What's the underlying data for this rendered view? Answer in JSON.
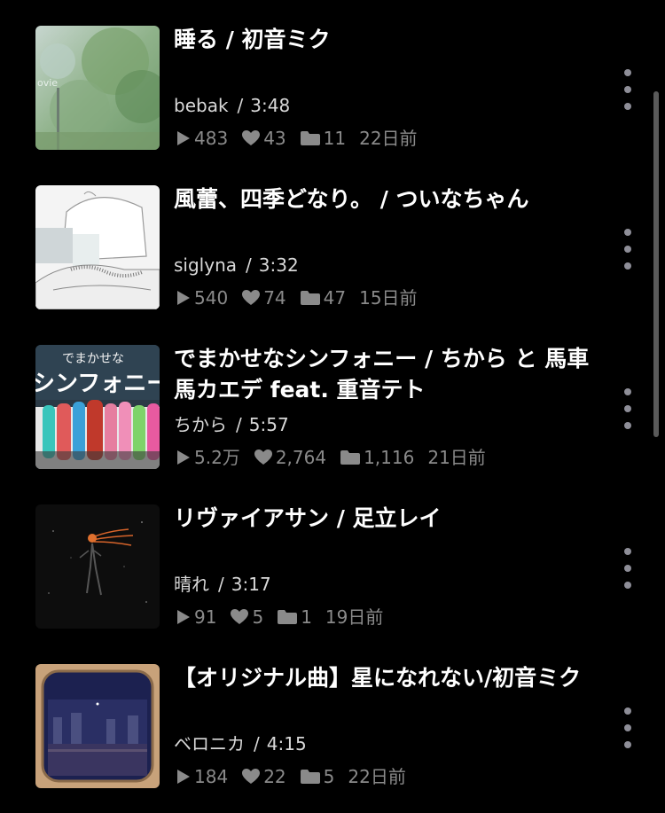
{
  "items": [
    {
      "title": "睡る / 初音ミク",
      "artist": "bebak",
      "duration": "3:48",
      "plays": "483",
      "likes": "43",
      "mylists": "11",
      "posted": "22日前",
      "thumb_overlay_text": "ovie"
    },
    {
      "title": "風蕾、四季どなり。 / ついなちゃん",
      "artist": "siglyna",
      "duration": "3:32",
      "plays": "540",
      "likes": "74",
      "mylists": "47",
      "posted": "15日前"
    },
    {
      "title": "でまかせなシンフォニー / ちから と 馬車馬カエデ feat. 重音テト",
      "artist": "ちから",
      "duration": "5:57",
      "plays": "5.2万",
      "likes": "2,764",
      "mylists": "1,116",
      "posted": "21日前",
      "thumb_text_top": "でまかせな",
      "thumb_text_main": "シンフォニー"
    },
    {
      "title": "リヴァイアサン / 足立レイ",
      "artist": "晴れ",
      "duration": "3:17",
      "plays": "91",
      "likes": "5",
      "mylists": "1",
      "posted": "19日前"
    },
    {
      "title": "【オリジナル曲】星になれない/初音ミク",
      "artist": "ベロニカ",
      "duration": "4:15",
      "plays": "184",
      "likes": "22",
      "mylists": "5",
      "posted": "22日前"
    }
  ],
  "separator": "/",
  "icons": {
    "plays": "play-icon",
    "likes": "heart-icon",
    "mylists": "folder-icon",
    "more": "more-vertical-icon"
  },
  "colors": {
    "background": "#000000",
    "title": "#ffffff",
    "meta": "#d8d8d8",
    "stats": "#8a8a8a",
    "more_dots": "#8e8e98",
    "scrollbar": "#5a5a5a"
  }
}
